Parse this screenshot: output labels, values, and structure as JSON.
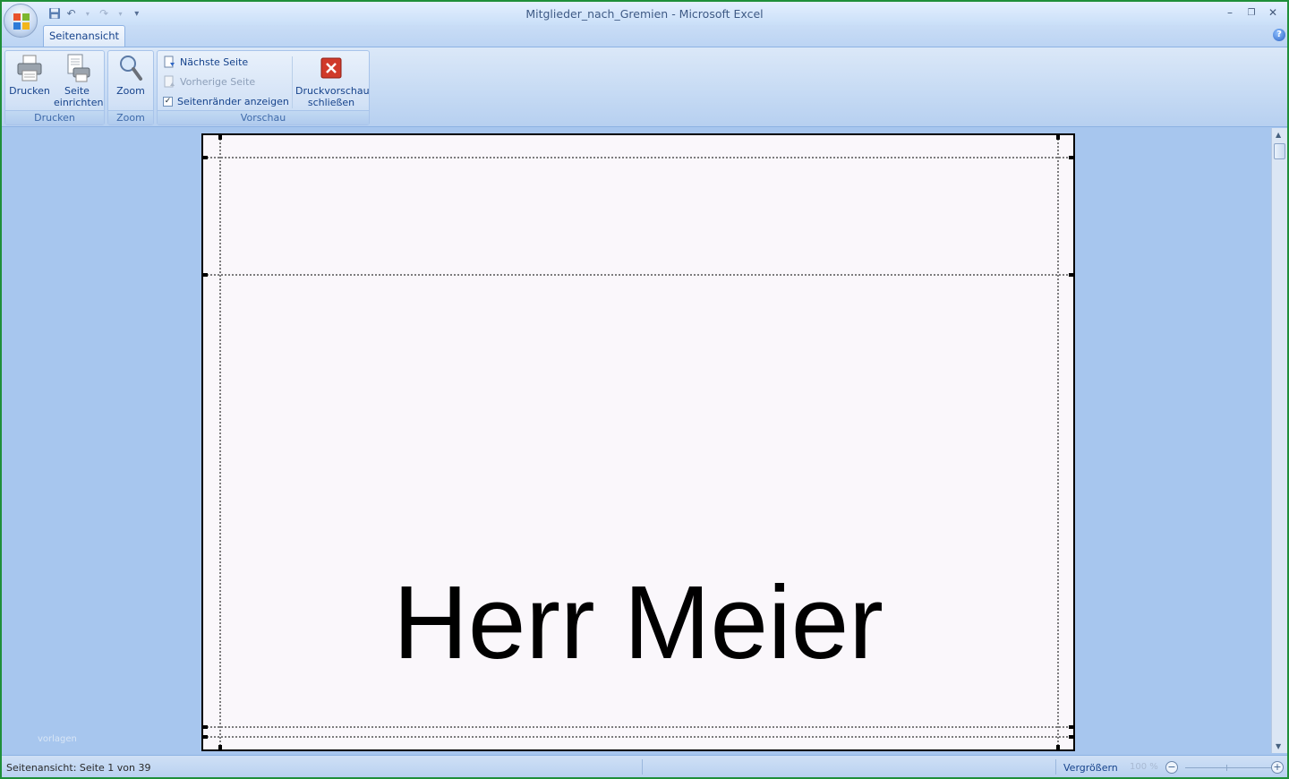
{
  "window": {
    "title": "Mitglieder_nach_Gremien - Microsoft Excel",
    "minimize_glyph": "–",
    "restore_glyph": "❐",
    "close_glyph": "✕"
  },
  "qat": {
    "save_icon": "save-icon",
    "undo_glyph": "↶",
    "redo_glyph": "↷",
    "customize_glyph": "▾"
  },
  "tabs": [
    {
      "label": "Seitenansicht",
      "active": true
    }
  ],
  "help": {
    "glyph": "?"
  },
  "ribbon": {
    "groups": {
      "drucken": {
        "label": "Drucken",
        "print_label": "Drucken",
        "setup_label_1": "Seite",
        "setup_label_2": "einrichten"
      },
      "zoom": {
        "label": "Zoom",
        "zoom_label": "Zoom"
      },
      "vorschau": {
        "label": "Vorschau",
        "next_page": "Nächste Seite",
        "prev_page": "Vorherige Seite",
        "show_margins": "Seitenränder anzeigen",
        "show_margins_checked": true,
        "close_label_1": "Druckvorschau",
        "close_label_2": "schließen"
      }
    }
  },
  "page": {
    "text": "Herr Meier"
  },
  "watermark": "vorlagen",
  "statusbar": {
    "text": "Seitenansicht: Seite 1 von 39",
    "zoom_label": "Vergrößern",
    "zoom_percent": "100 %",
    "zoom_out_glyph": "−",
    "zoom_in_glyph": "+"
  },
  "colors": {
    "frame": "#1f8f3a",
    "workspace": "#a7c6ee",
    "ribbon_text": "#15428b",
    "close_button": "#d03a2a"
  }
}
